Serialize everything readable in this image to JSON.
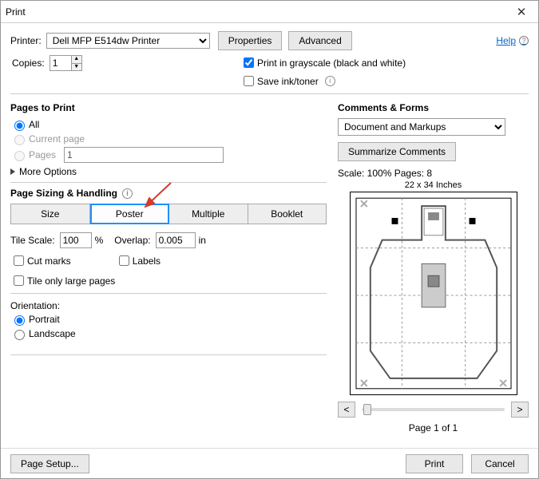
{
  "window": {
    "title": "Print"
  },
  "printerRow": {
    "label": "Printer:",
    "selected": "Dell MFP E514dw Printer",
    "properties": "Properties",
    "advanced": "Advanced",
    "help": "Help"
  },
  "copies": {
    "label": "Copies:",
    "value": "1"
  },
  "options": {
    "grayscale": "Print in grayscale (black and white)",
    "saveInk": "Save ink/toner"
  },
  "pagesToPrint": {
    "heading": "Pages to Print",
    "all": "All",
    "current": "Current page",
    "pages": "Pages",
    "pagesValue": "1",
    "more": "More Options"
  },
  "sizing": {
    "heading": "Page Sizing & Handling",
    "tabs": {
      "size": "Size",
      "poster": "Poster",
      "multiple": "Multiple",
      "booklet": "Booklet"
    },
    "tileScaleLabel": "Tile Scale:",
    "tileScaleValue": "100",
    "tileScaleUnit": "%",
    "overlapLabel": "Overlap:",
    "overlapValue": "0.005",
    "overlapUnit": "in",
    "cutMarks": "Cut marks",
    "labels": "Labels",
    "tileOnly": "Tile only large pages"
  },
  "orientation": {
    "heading": "Orientation:",
    "portrait": "Portrait",
    "landscape": "Landscape"
  },
  "comments": {
    "heading": "Comments & Forms",
    "selected": "Document and Markups",
    "summarize": "Summarize Comments"
  },
  "preview": {
    "scaleLine": "Scale: 100% Pages: 8",
    "dims": "22 x 34 Inches",
    "prev": "<",
    "next": ">",
    "pageLabel": "Page 1 of 1"
  },
  "footer": {
    "pageSetup": "Page Setup...",
    "print": "Print",
    "cancel": "Cancel"
  }
}
